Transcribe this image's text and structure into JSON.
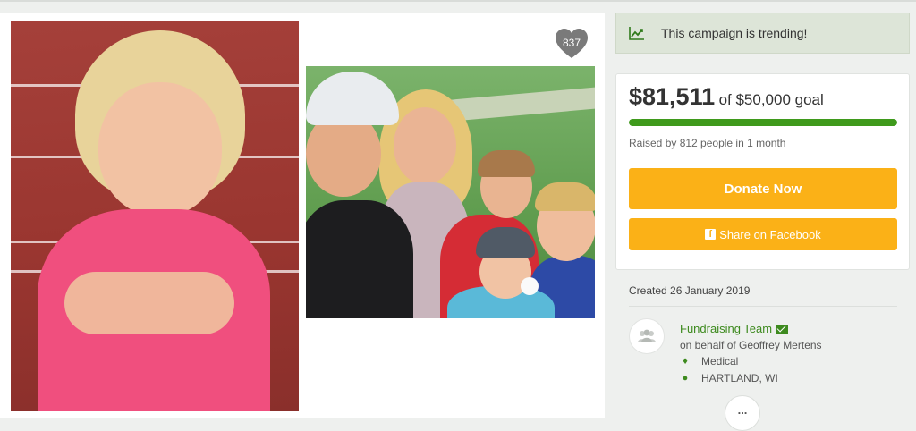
{
  "gallery": {
    "likes_count": "837",
    "photos": [
      {
        "name": "girl-photo"
      },
      {
        "name": "family-photo"
      }
    ]
  },
  "trending": {
    "icon": "trending-chart-icon",
    "text": "This campaign is trending!"
  },
  "donation": {
    "amount": "$81,511",
    "goal_text": "of $50,000 goal",
    "progress_fraction": 1.0,
    "raised_text": "Raised by 812 people in 1 month",
    "donate_label": "Donate Now",
    "share_label": "Share on Facebook",
    "accent_color": "#fbb117",
    "progress_color": "#3f9a1c"
  },
  "details": {
    "created": "Created 26 January 2019",
    "team_name": "Fundraising Team",
    "on_behalf": "on behalf of Geoffrey Mertens",
    "category": "Medical",
    "location": "HARTLAND, WI",
    "more_label": "..."
  }
}
